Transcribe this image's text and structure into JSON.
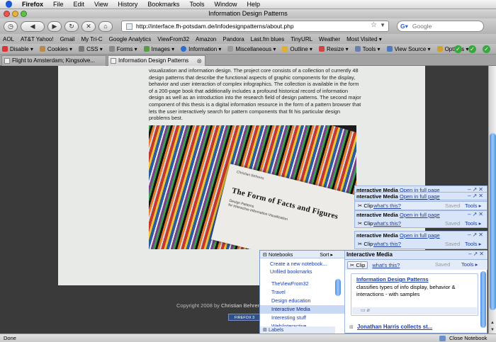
{
  "menubar": {
    "app": "Firefox",
    "items": [
      "File",
      "Edit",
      "View",
      "History",
      "Bookmarks",
      "Tools",
      "Window",
      "Help"
    ]
  },
  "window": {
    "title": "Information Design Patterns"
  },
  "navbar": {
    "url": "http://interface.fh-potsdam.de/infodesignpatterns/about.php",
    "search_placeholder": "Google"
  },
  "bookmarks": [
    "AOL",
    "AT&T Yahoo!",
    "Gmail",
    "My Tri-C",
    "Google Analytics",
    "ViewFrom32",
    "Amazon",
    "Pandora",
    "Last.fm blues",
    "TinyURL",
    "Weather",
    "Most Visited ▾"
  ],
  "devbar": [
    "Disable ▾",
    "Cookies ▾",
    "CSS ▾",
    "Forms ▾",
    "Images ▾",
    "Information ▾",
    "Miscellaneous ▾",
    "Outline ▾",
    "Resize ▾",
    "Tools ▾",
    "View Source ▾",
    "Options ▾"
  ],
  "tabs": [
    {
      "label": "Flight to Amsterdam; Kingsolve..."
    },
    {
      "label": "Information Design Patterns"
    }
  ],
  "page": {
    "body_text": "visualization and information design. The project core consists of a collection of currently 48 design patterns that describe the functional aspects of graphic components for the display, behavior and user interaction of complex infographics. The collection is available in the form of a 200-page book that additionally includes a profound historical record of information design as well as an introduction into the research field of design patterns. The second major component of this thesis is a digital information resource in the form of a pattern browser that lets the user interactively search for pattern components that fit his particular design problems best.",
    "book_title": "The Form of Facts and Figures",
    "book_author": "Christian Behrens",
    "book_subtitle_1": "Design Patterns",
    "book_subtitle_2": "for Interactive Information Visualization",
    "copyright_prefix": "Copyright 2008 by",
    "copyright_name": "Christian Behrens",
    "ff_badge": "FIREFOX 3"
  },
  "notebook_panels": [
    {
      "title": "nteractive Media",
      "open": "Open in full page"
    },
    {
      "title": "nteractive Media",
      "open": "Open in full page"
    },
    {
      "title": "nteractive Media",
      "open": "Open in full page"
    },
    {
      "title": "nteractive Media",
      "open": "Open in full page"
    }
  ],
  "notebook_bars": {
    "clip": "Clip",
    "whats_this": "what's this?",
    "saved": "Saved",
    "tools": "Tools ▸"
  },
  "notebook": {
    "header_title": "Interactive Media",
    "list_header": "Notebooks",
    "sort_label": "Sort ▸",
    "create_action": "Create a new notebook...",
    "unfiled_action": "Unfiled bookmarks",
    "notebooks": [
      "TheViewFrom32",
      "Travel",
      "Design education",
      "Interactive Media",
      "Interesting stuff",
      "Web/interactive"
    ],
    "selected_index": 3,
    "labels": "Labels",
    "note1_title": "Information Design Patterns",
    "note1_text": "classifies types of info display, behavior & interactions - with samples",
    "note2_title": "Jonathan Harris collects st..."
  },
  "status": {
    "left": "Done",
    "right": "Close Notebook"
  }
}
